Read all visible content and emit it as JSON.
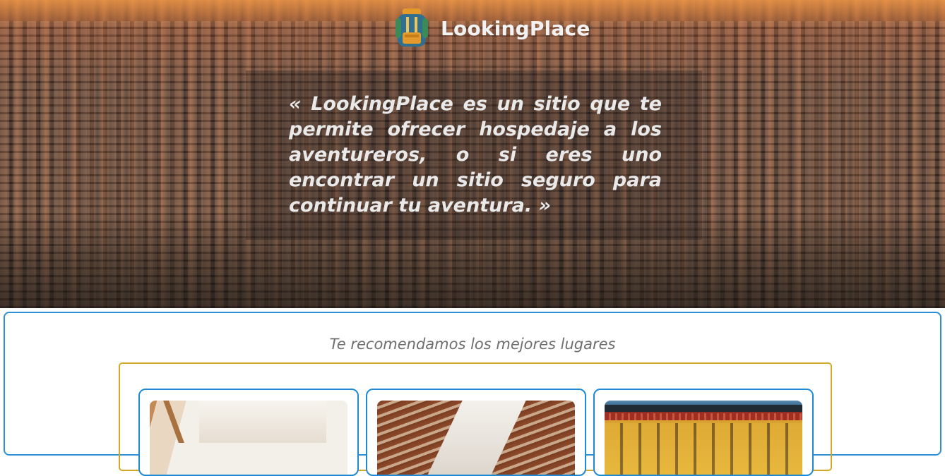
{
  "header": {
    "brand_name": "LookingPlace",
    "logo_icon": "backpack-icon"
  },
  "hero": {
    "quote": "« LookingPlace es un sitio que te permite ofrecer hospedaje a los aventureros, o si eres uno encontrar un sitio seguro para continuar tu aventura. »"
  },
  "recommendations": {
    "title": "Te recomendamos los mejores lugares",
    "cards": [
      {
        "image": "place-photo"
      },
      {
        "image": "place-photo"
      },
      {
        "image": "place-photo"
      }
    ]
  },
  "colors": {
    "card_border": "#1f8ad4",
    "section_border": "#2d8fd6",
    "frame_border": "#d3a82a",
    "quote_text": "#e9e9e9",
    "title_text": "#6e6e6e"
  }
}
